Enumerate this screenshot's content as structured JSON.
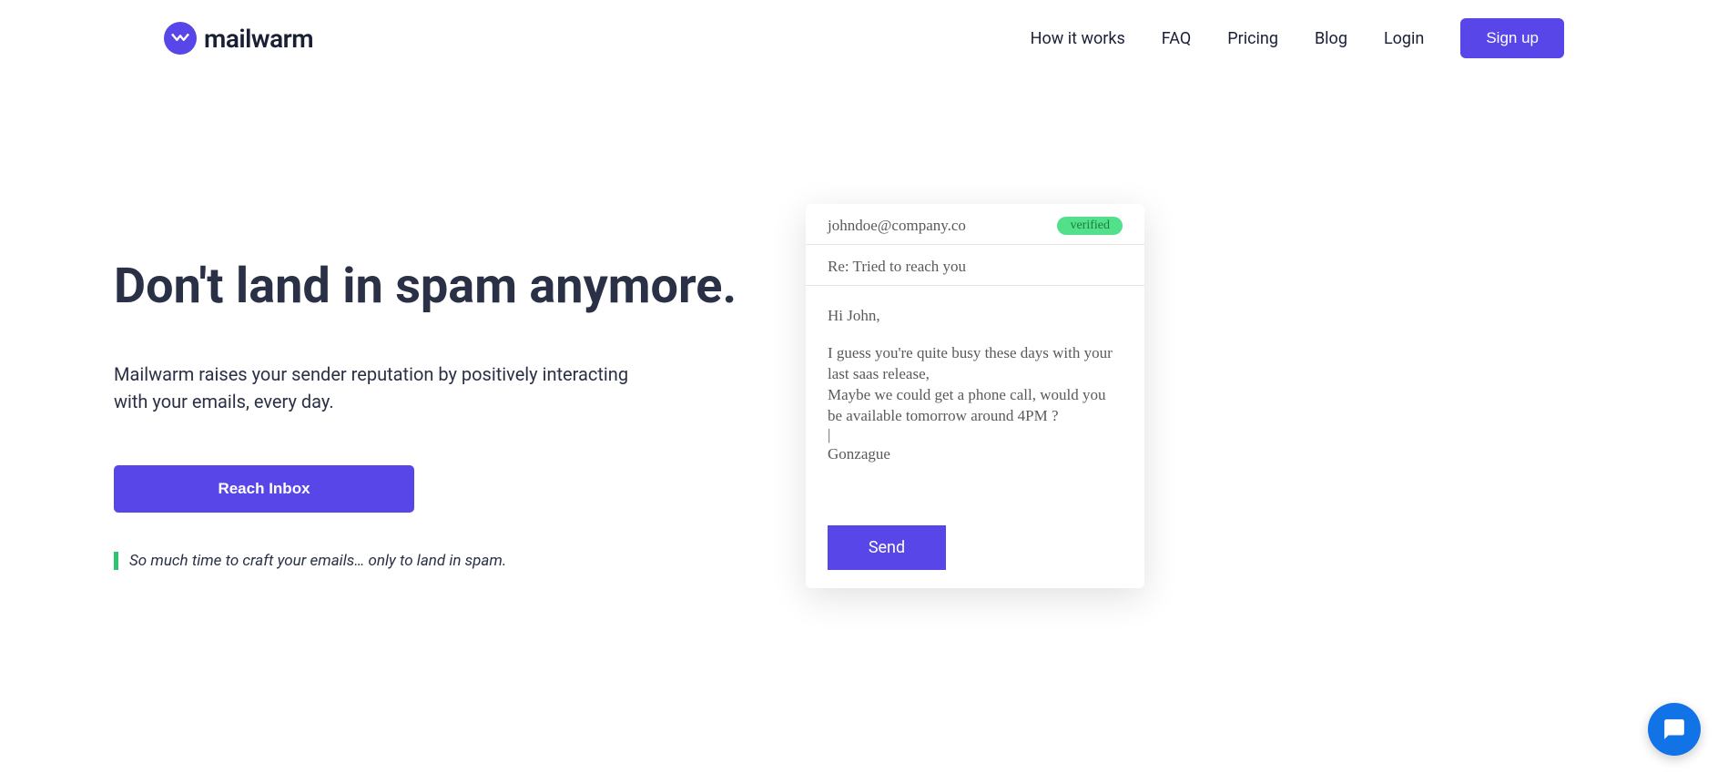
{
  "header": {
    "logo_text": "mailwarm",
    "nav": {
      "how_it_works": "How it works",
      "faq": "FAQ",
      "pricing": "Pricing",
      "blog": "Blog",
      "login": "Login",
      "signup": "Sign up"
    }
  },
  "hero": {
    "headline": "Don't land in spam anymore.",
    "sub_line1": "Mailwarm raises your sender reputation by positively interacting",
    "sub_line2": " with your emails, every day.",
    "cta": "Reach Inbox",
    "tagline": "So much time to craft your emails… only to land in spam."
  },
  "email": {
    "from": "johndoe@company.co",
    "verified": "verified",
    "subject": "Re: Tried to reach you",
    "greeting": "Hi John,",
    "body_line1": "I guess you're quite busy these days with your last saas release,",
    "body_line2": "Maybe we could get a phone call, would you be available tomorrow around 4PM ?",
    "cursor": "|",
    "signature": "Gonzague",
    "send": "Send"
  }
}
